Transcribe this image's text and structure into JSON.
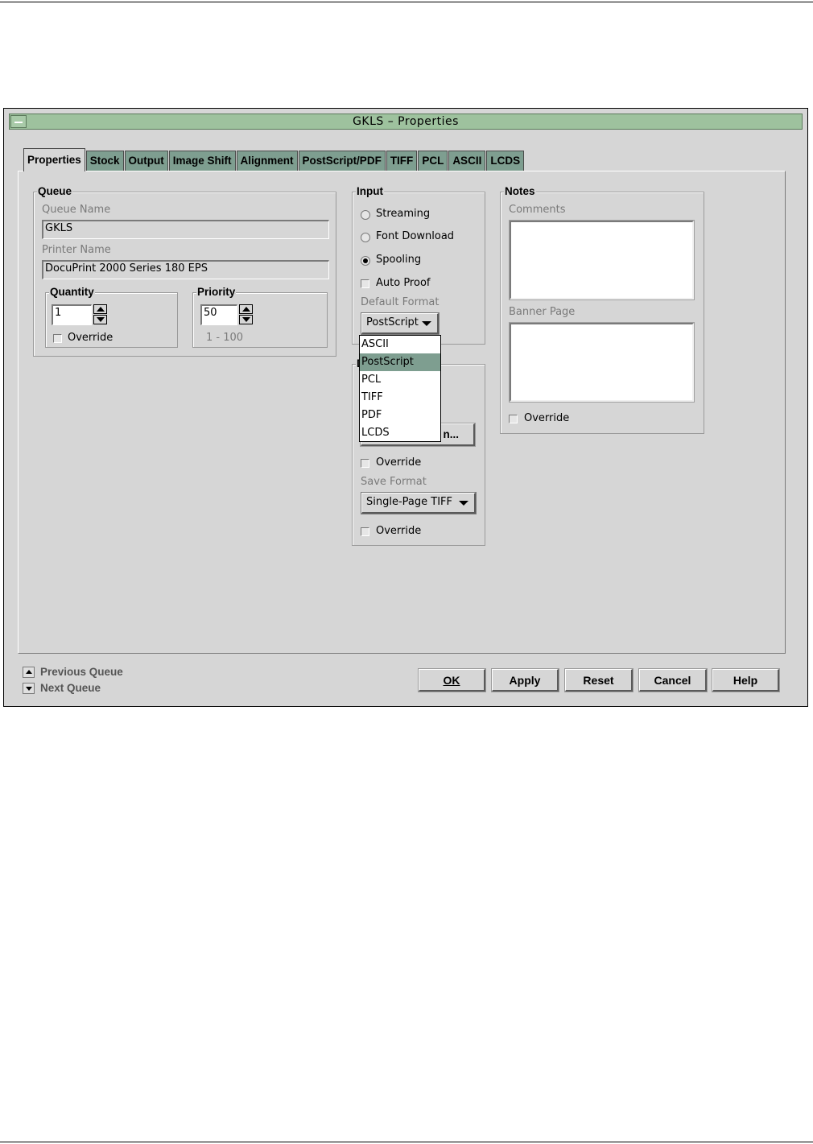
{
  "window": {
    "title": "GKLS – Properties"
  },
  "tabs": [
    "Properties",
    "Stock",
    "Output",
    "Image Shift",
    "Alignment",
    "PostScript/PDF",
    "TIFF",
    "PCL",
    "ASCII",
    "LCDS"
  ],
  "queue": {
    "title": "Queue",
    "queue_name_label": "Queue Name",
    "queue_name_value": "GKLS",
    "printer_name_label": "Printer Name",
    "printer_name_value": "DocuPrint 2000 Series 180 EPS",
    "quantity": {
      "title": "Quantity",
      "value": "1",
      "override_label": "Override"
    },
    "priority": {
      "title": "Priority",
      "value": "50",
      "range": "1 - 100"
    }
  },
  "input": {
    "title": "Input",
    "modes": [
      {
        "label": "Streaming",
        "selected": false
      },
      {
        "label": "Font Download",
        "selected": false
      },
      {
        "label": "Spooling",
        "selected": true
      }
    ],
    "auto_proof_label": "Auto Proof",
    "default_format_label": "Default Format",
    "default_format_value": "PostScript",
    "dropdown_options": [
      "ASCII",
      "PostScript",
      "PCL",
      "TIFF",
      "PDF",
      "LCDS"
    ],
    "dropdown_selected": "PostScript"
  },
  "lower_group": {
    "title_partial": "D",
    "button_partial": "n...",
    "override1_label": "Override",
    "save_format_label": "Save Format",
    "save_format_value": "Single-Page TIFF",
    "override2_label": "Override"
  },
  "notes": {
    "title": "Notes",
    "comments_label": "Comments",
    "banner_page_label": "Banner Page",
    "override_label": "Override"
  },
  "nav": {
    "previous_queue": "Previous Queue",
    "next_queue": "Next Queue"
  },
  "buttons": {
    "ok": "OK",
    "apply": "Apply",
    "reset": "Reset",
    "cancel": "Cancel",
    "help": "Help"
  }
}
